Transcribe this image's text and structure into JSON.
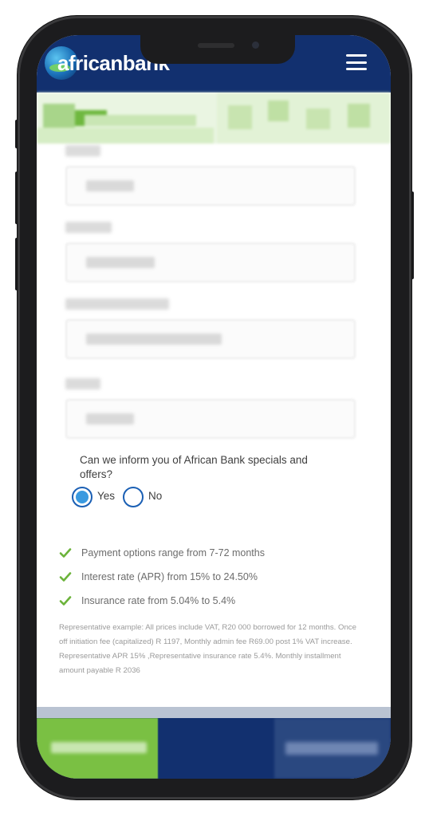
{
  "header": {
    "logo_text": "africanbank"
  },
  "form": {
    "question": "Can we inform you of African Bank specials and offers?",
    "options": [
      {
        "label": "Yes",
        "selected": true
      },
      {
        "label": "No",
        "selected": false
      }
    ]
  },
  "features": [
    "Payment options range from 7-72 months",
    "Interest rate (APR) from 15% to 24.50%",
    "Insurance rate from 5.04% to 5.4%"
  ],
  "disclaimer": "Representative example: All prices include VAT, R20 000 borrowed for 12 months. Once off initiation fee (capitalized) R 1197, Monthly admin fee R69.00 post 1% VAT increase. Representative APR 15% ,Representative insurance rate 5.4%. Monthly installment amount payable R 2036",
  "colors": {
    "brand_navy": "#12306f",
    "brand_green": "#7ac043",
    "check_green": "#6bb33a",
    "radio_blue": "#3a9ae0"
  },
  "icons": {
    "menu": "hamburger-icon",
    "check": "checkmark-icon"
  }
}
